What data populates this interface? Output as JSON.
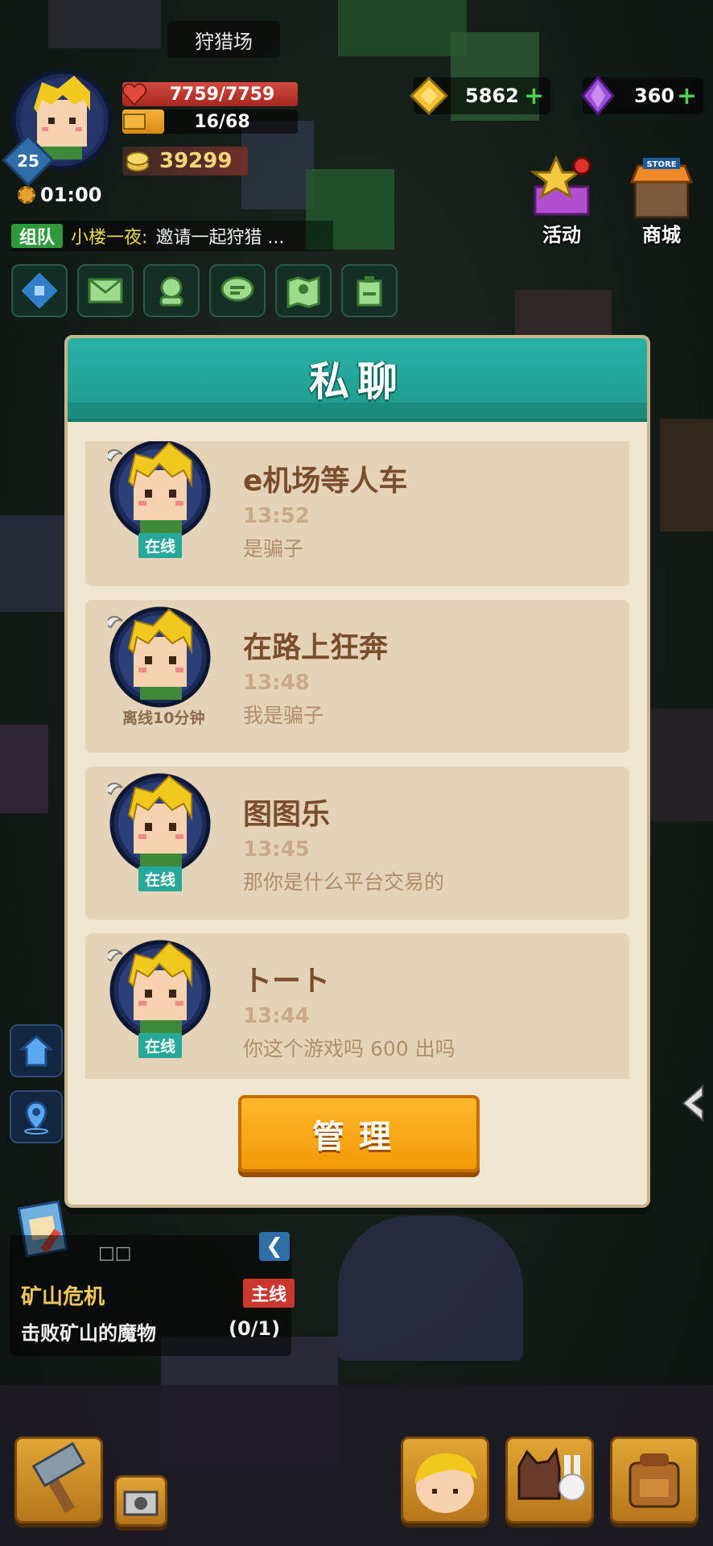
{
  "hud": {
    "zone_name": "狩猎场",
    "player": {
      "level": "25",
      "hp": "7759/7759",
      "hp_fraction": 1.0,
      "xp": "16/68",
      "xp_fraction": 0.24,
      "coins": "39299",
      "timer": "01:00"
    },
    "team": {
      "tag": "组队",
      "sender": "小楼一夜:",
      "message": "邀请一起狩猎 ..."
    },
    "quick_icons": [
      "layout-icon",
      "mail-icon",
      "friends-icon",
      "chat-icon",
      "map-icon",
      "badge-icon"
    ],
    "currency": {
      "gold": "5862",
      "gems": "360",
      "gold_color": "#f2c230",
      "gem_color": "#9b4fd6"
    },
    "features": {
      "activity": "活动",
      "store": "商城",
      "store_sign": "STORE"
    }
  },
  "modal": {
    "title": "私聊",
    "chats": [
      {
        "name": "e机场等人车",
        "time": "13:52",
        "message": "是骗子",
        "status": "在线",
        "online": true
      },
      {
        "name": "在路上狂奔",
        "time": "13:48",
        "message": "我是骗子",
        "status": "离线10分钟",
        "online": false
      },
      {
        "name": "图图乐",
        "time": "13:45",
        "message": "那你是什么平台交易的",
        "status": "在线",
        "online": true
      },
      {
        "name": "トート",
        "time": "13:44",
        "message": "你这个游戏吗  600 出吗",
        "status": "在线",
        "online": true
      }
    ],
    "manage_label": "管理"
  },
  "quest": {
    "dots": "□□",
    "title": "矿山危机",
    "tag": "主线",
    "description": "击败矿山的魔物",
    "progress": "(0/1)"
  },
  "colors": {
    "teal": "#29b2a4",
    "panel": "#f0e5cf",
    "row": "#e5d3b7",
    "orange": "#f19a06"
  }
}
